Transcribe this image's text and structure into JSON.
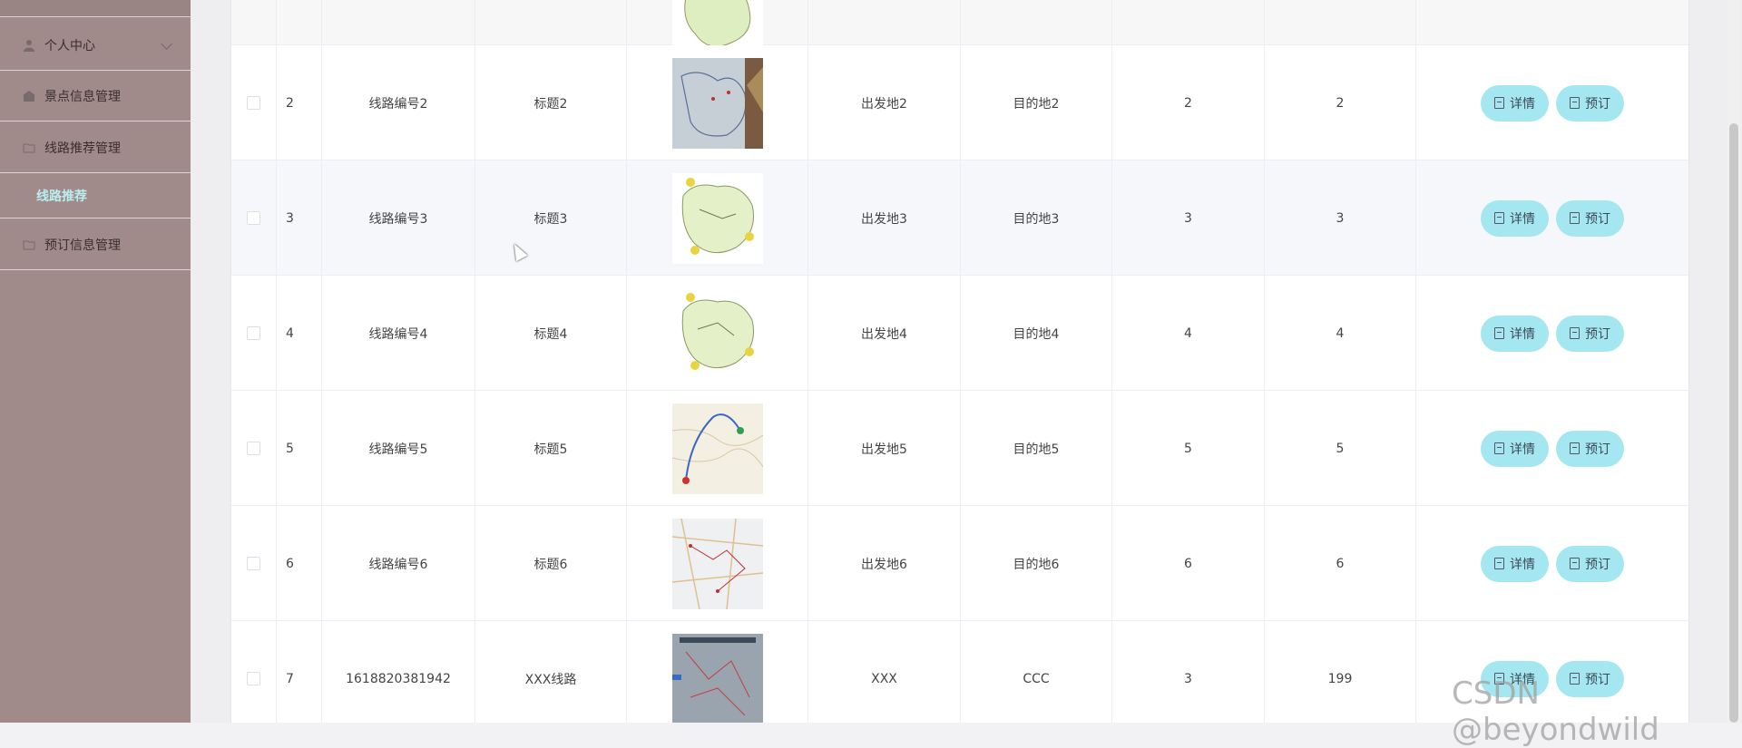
{
  "sidebar": {
    "items": [
      {
        "label": "个人中心",
        "icon": "user-icon"
      },
      {
        "label": "景点信息管理",
        "icon": "place-icon"
      },
      {
        "label": "线路推荐管理",
        "icon": "folder-icon"
      },
      {
        "label": "预订信息管理",
        "icon": "folder-icon"
      }
    ],
    "active_sub": "线路推荐"
  },
  "table": {
    "rows": [
      {
        "idx": "2",
        "code": "线路编号2",
        "title": "标题2",
        "from": "出发地2",
        "to": "目的地2",
        "n1": "2",
        "n2": "2",
        "thumb": "map-yunnan"
      },
      {
        "idx": "3",
        "code": "线路编号3",
        "title": "标题3",
        "from": "出发地3",
        "to": "目的地3",
        "n1": "3",
        "n2": "3",
        "thumb": "map-green"
      },
      {
        "idx": "4",
        "code": "线路编号4",
        "title": "标题4",
        "from": "出发地4",
        "to": "目的地4",
        "n1": "4",
        "n2": "4",
        "thumb": "map-green"
      },
      {
        "idx": "5",
        "code": "线路编号5",
        "title": "标题5",
        "from": "出发地5",
        "to": "目的地5",
        "n1": "5",
        "n2": "5",
        "thumb": "map-route"
      },
      {
        "idx": "6",
        "code": "线路编号6",
        "title": "标题6",
        "from": "出发地6",
        "to": "目的地6",
        "n1": "6",
        "n2": "6",
        "thumb": "map-road"
      },
      {
        "idx": "7",
        "code": "1618820381942",
        "title": "XXX线路",
        "from": "XXX",
        "to": "CCC",
        "n1": "3",
        "n2": "199",
        "thumb": "map-grey"
      }
    ],
    "detail_label": "详情",
    "book_label": "预订"
  },
  "watermark": "CSDN @beyondwild",
  "colors": {
    "sidebar": "#a08a8a",
    "active_sub": "#b8eef0",
    "button": "#a5e7f0"
  }
}
